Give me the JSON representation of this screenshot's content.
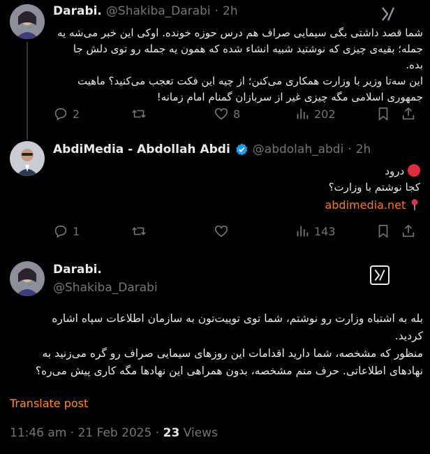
{
  "tweets": [
    {
      "name": "Darabi.",
      "handle": "@Shakiba_Darabi",
      "time": "2h",
      "lines": [
        "شما قصد داشتی بگی سیمایی صراف هم درس حوزه خونده. اوکی این خبر می‌شه یه",
        "جمله؛ بقیه‌ی چیزی که نوشتید شبیه انشاء شده که همون یه جمله رو توی دلش جا بده.",
        "این سه‌تا وزیر با وزارت همکاری می‌کنن؛ از چیه این فکت تعجب می‌کنید؟ ماهیت",
        "جمهوری اسلامی مگه چیزی غیر از سربازان گمنام امام زمانه!"
      ],
      "actions": {
        "replies": "2",
        "reposts": "",
        "likes": "8",
        "views": "202"
      }
    },
    {
      "name": "AbdiMedia - Abdollah Abdi",
      "handle": "@abdolah_abdi",
      "time": "2h",
      "lines": [
        "درود",
        "کجا نوشتم با وزارت؟"
      ],
      "link": "abdimedia.net",
      "actions": {
        "replies": "1",
        "reposts": "",
        "likes": "",
        "views": "143"
      }
    },
    {
      "name": "Darabi.",
      "handle": "@Shakiba_Darabi",
      "lines": [
        "بله به اشتباه وزارت رو نوشتم، شما توی توییت‌تون به  سازمان اطلاعات سپاه اشاره",
        "کردید.",
        "منظور که مشخصه، شما دارید اقدامات این روزهای سیمایی صراف رو گره می‌زنید به",
        "نهادهای اطلاعاتی. حرف منم مشخصه، بدون همراهی این نهادها مگه کاری پیش می‌ره؟"
      ],
      "translate": "Translate post",
      "timestamp": "11:46 am · 21 Feb 2025 · ",
      "views_count": "23",
      "views_label": " Views"
    }
  ],
  "icons": {
    "reply": "reply-icon",
    "repost": "repost-icon",
    "like": "heart-icon",
    "views": "views-icon",
    "bookmark": "bookmark-icon",
    "share": "share-icon",
    "grok": "grok-icon",
    "verified": "verified-badge-icon",
    "red_circle": "red-circle-emoji",
    "pin": "round-pushpin-emoji"
  },
  "colors": {
    "background": "#000000",
    "text": "#e7e9ea",
    "muted": "#71767b",
    "link": "#ff7a00",
    "verified": "#1d9bf0"
  }
}
